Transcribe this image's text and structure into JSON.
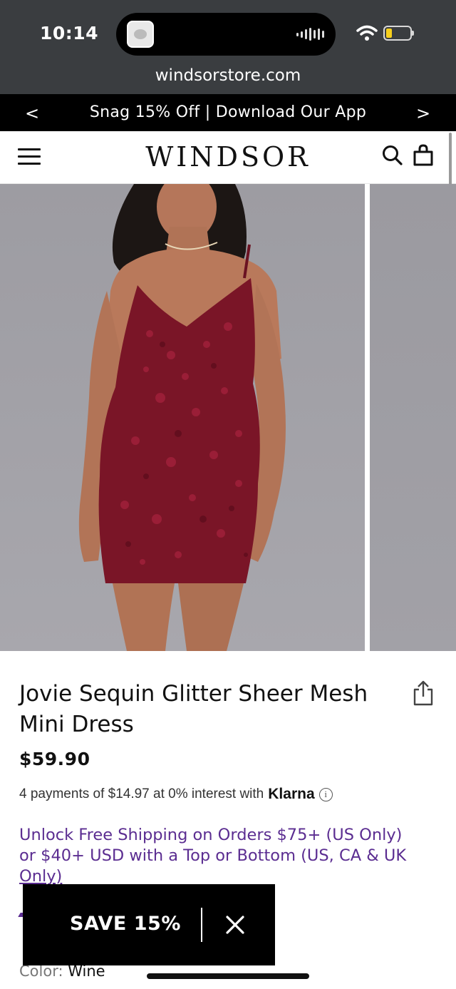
{
  "status_bar": {
    "time": "10:14",
    "url": "windsorstore.com"
  },
  "promo_bar": {
    "text": "Snag 15% Off | Download Our App",
    "prev_arrow": "<",
    "next_arrow": ">"
  },
  "header": {
    "logo": "WINDSOR",
    "icons": [
      "menu-icon",
      "search-icon",
      "shopping-bag-icon"
    ]
  },
  "gallery": {
    "subject": "Model wearing wine sequin mini dress"
  },
  "product": {
    "title": "Jovie Sequin Glitter Sheer Mesh Mini Dress",
    "price": "$59.90",
    "klarna_text": "4 payments of $14.97 at 0% interest with",
    "klarna_brand": "Klarna",
    "info_glyph": "i",
    "shipping_line1": "Unlock Free Shipping on Orders $75+ (US Only)",
    "shipping_line2": "or $40+ USD with a Top or Bottom (US, CA & UK",
    "shipping_line3": "Only)",
    "color_label": "Color:",
    "color_value": "Wine"
  },
  "popup": {
    "label": "SAVE 15%"
  },
  "colors": {
    "accent_purple": "#5b2d91",
    "status_bar_bg": "#3a3d40",
    "promo_bg": "#000000",
    "dress_wine": "#7a1527"
  }
}
